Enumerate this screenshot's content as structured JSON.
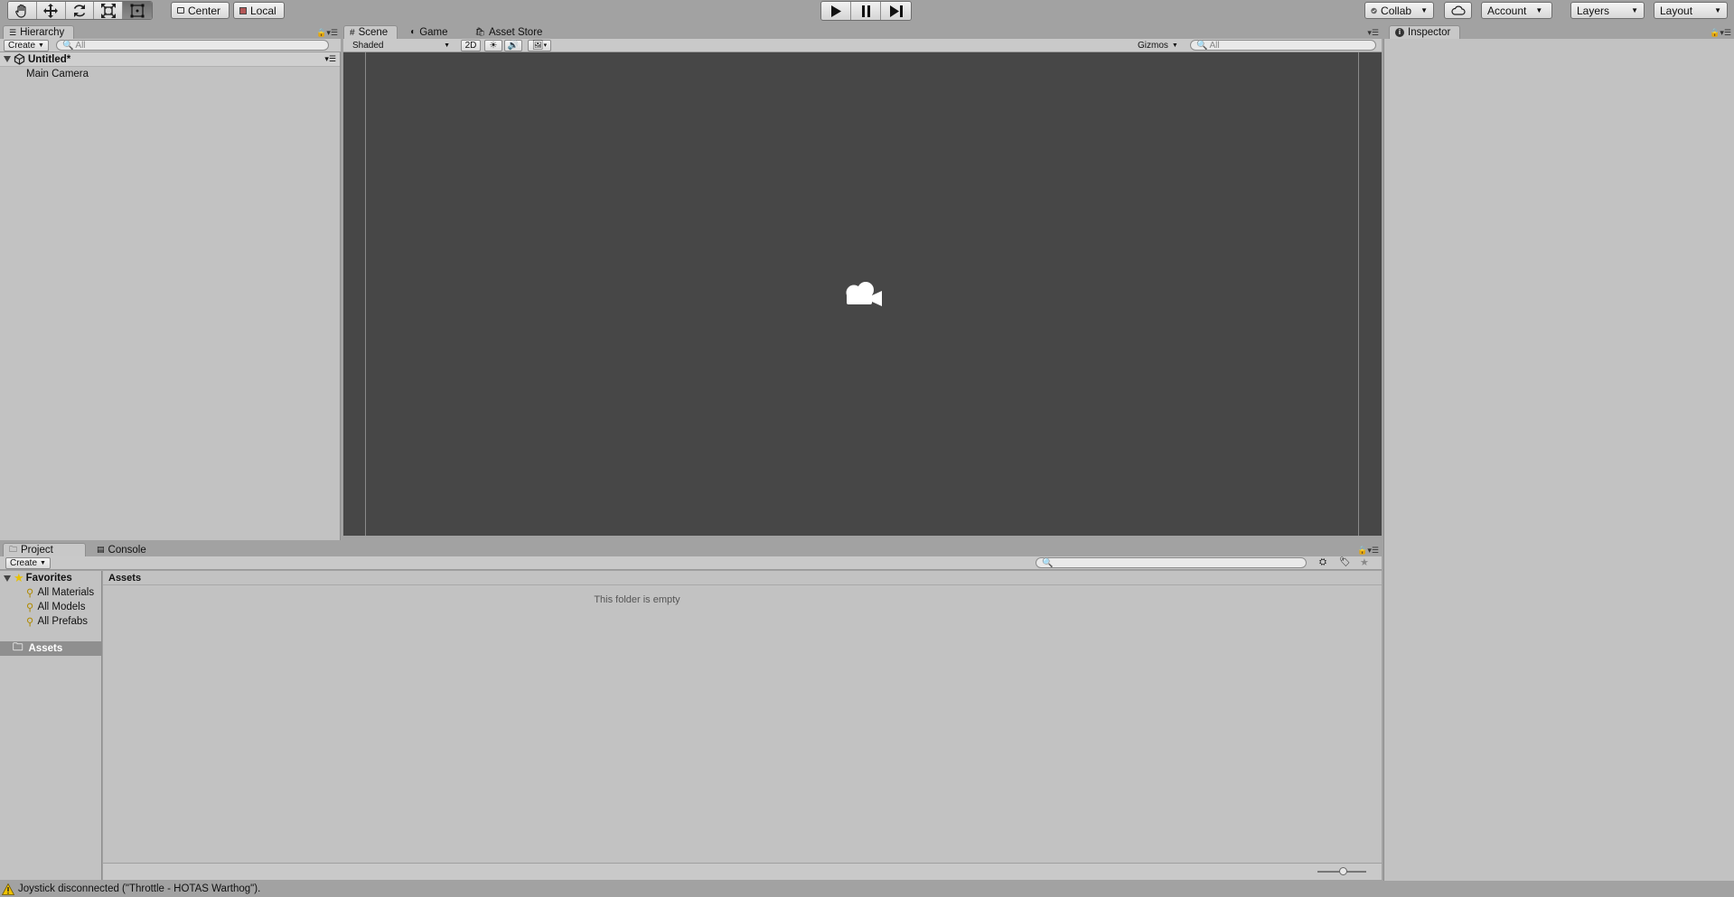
{
  "toolbar": {
    "transform_tools": [
      {
        "name": "hand-tool",
        "icon": "hand-icon"
      },
      {
        "name": "move-tool",
        "icon": "move-icon"
      },
      {
        "name": "rotate-tool",
        "icon": "rotate-icon"
      },
      {
        "name": "scale-tool",
        "icon": "scale-icon"
      },
      {
        "name": "rect-tool",
        "icon": "rect-tool-icon",
        "active": true
      }
    ],
    "pivot_label": "Center",
    "space_label": "Local",
    "collab_label": "Collab",
    "account_label": "Account",
    "layers_label": "Layers",
    "layout_label": "Layout"
  },
  "hierarchy": {
    "tab_label": "Hierarchy",
    "create_label": "Create",
    "search_placeholder": "All",
    "scene_name": "Untitled*",
    "items": [
      "Main Camera"
    ]
  },
  "scene_view": {
    "tabs": [
      {
        "label": "Scene",
        "icon": "scene-grid-icon",
        "active": true
      },
      {
        "label": "Game",
        "icon": "game-icon",
        "active": false
      },
      {
        "label": "Asset Store",
        "icon": "asset-store-icon",
        "active": false
      }
    ],
    "shading_mode": "Shaded",
    "mode_2d_label": "2D",
    "gizmos_label": "Gizmos",
    "search_placeholder": "All",
    "background_color": "#474747"
  },
  "inspector": {
    "tab_label": "Inspector"
  },
  "project": {
    "tabs": [
      {
        "label": "Project",
        "icon": "folder-icon",
        "active": true
      },
      {
        "label": "Console",
        "icon": "console-icon",
        "active": false
      }
    ],
    "create_label": "Create",
    "favorites_label": "Favorites",
    "favorites": [
      "All Materials",
      "All Models",
      "All Prefabs"
    ],
    "assets_root_label": "Assets",
    "breadcrumb": "Assets",
    "empty_message": "This folder is empty"
  },
  "status_bar": {
    "message": "Joystick disconnected (\"Throttle - HOTAS Warthog\")."
  },
  "colors": {
    "chrome": "#a2a2a2",
    "panel": "#c2c2c2",
    "warning": "#f2c300"
  }
}
